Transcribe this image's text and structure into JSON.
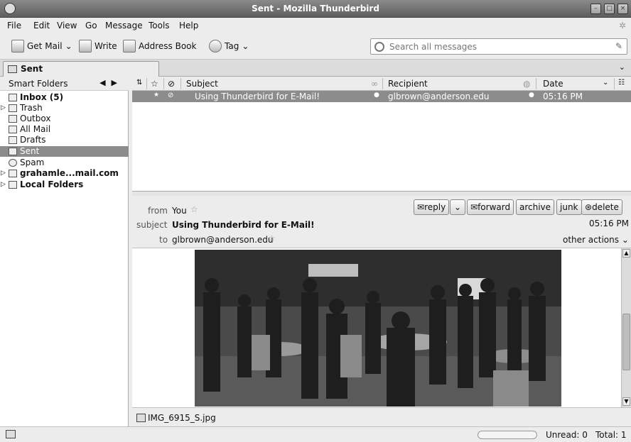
{
  "window": {
    "title": "Sent - Mozilla Thunderbird"
  },
  "menu": [
    "File",
    "Edit",
    "View",
    "Go",
    "Message",
    "Tools",
    "Help"
  ],
  "toolbar": {
    "get_mail": "Get Mail",
    "write": "Write",
    "address_book": "Address Book",
    "tag": "Tag",
    "search_placeholder": "Search all messages"
  },
  "tab": {
    "label": "Sent"
  },
  "folders": {
    "header": "Smart Folders",
    "items": [
      {
        "label": "Inbox (5)",
        "bold": true
      },
      {
        "label": "Trash",
        "twisty": true
      },
      {
        "label": "Outbox"
      },
      {
        "label": "All Mail"
      },
      {
        "label": "Drafts"
      },
      {
        "label": "Sent",
        "selected": true
      },
      {
        "label": "Spam"
      },
      {
        "label": "grahamle...mail.com",
        "bold": true,
        "twisty": true
      },
      {
        "label": "Local Folders",
        "bold": true,
        "twisty": true
      }
    ]
  },
  "thread": {
    "columns": {
      "subject": "Subject",
      "recipient": "Recipient",
      "date": "Date"
    },
    "rows": [
      {
        "subject": "Using Thunderbird for E-Mail!",
        "recipient": "glbrown@anderson.edu",
        "date": "05:16 PM"
      }
    ]
  },
  "message": {
    "from_label": "from",
    "from": "You",
    "subject_label": "subject",
    "subject": "Using Thunderbird for E-Mail!",
    "to_label": "to",
    "to": "glbrown@anderson.edu",
    "time": "05:16 PM",
    "buttons": {
      "reply": "reply",
      "forward": "forward",
      "archive": "archive",
      "junk": "junk",
      "delete": "delete"
    },
    "other_actions": "other actions"
  },
  "attachment": {
    "name": "IMG_6915_S.jpg"
  },
  "status": {
    "unread": "Unread: 0",
    "total": "Total: 1",
    "progress": 0
  }
}
